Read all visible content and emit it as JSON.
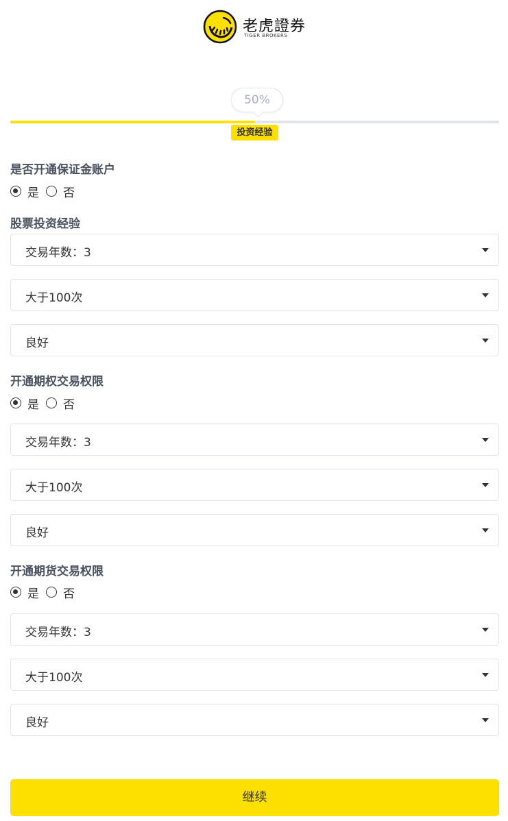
{
  "header": {
    "brand_cn": "老虎證券",
    "brand_en": "TIGER BROKERS"
  },
  "progress": {
    "percent_label": "50%",
    "value": 0.5,
    "step_label": "投资经验"
  },
  "margin": {
    "title": "是否开通保证金账户",
    "yes": "是",
    "no": "否",
    "selected": "yes"
  },
  "stock": {
    "title": "股票投资经验",
    "years": "交易年数：3",
    "frequency": "大于100次",
    "knowledge": "良好"
  },
  "options": {
    "title": "开通期权交易权限",
    "yes": "是",
    "no": "否",
    "selected": "yes",
    "years": "交易年数：3",
    "frequency": "大于100次",
    "knowledge": "良好"
  },
  "futures": {
    "title": "开通期货交易权限",
    "yes": "是",
    "no": "否",
    "selected": "yes",
    "years": "交易年数：3",
    "frequency": "大于100次",
    "knowledge": "良好"
  },
  "actions": {
    "continue_label": "继续"
  },
  "colors": {
    "accent": "#fde000",
    "track": "#e1e5ea",
    "section_title": "#4a5260"
  }
}
